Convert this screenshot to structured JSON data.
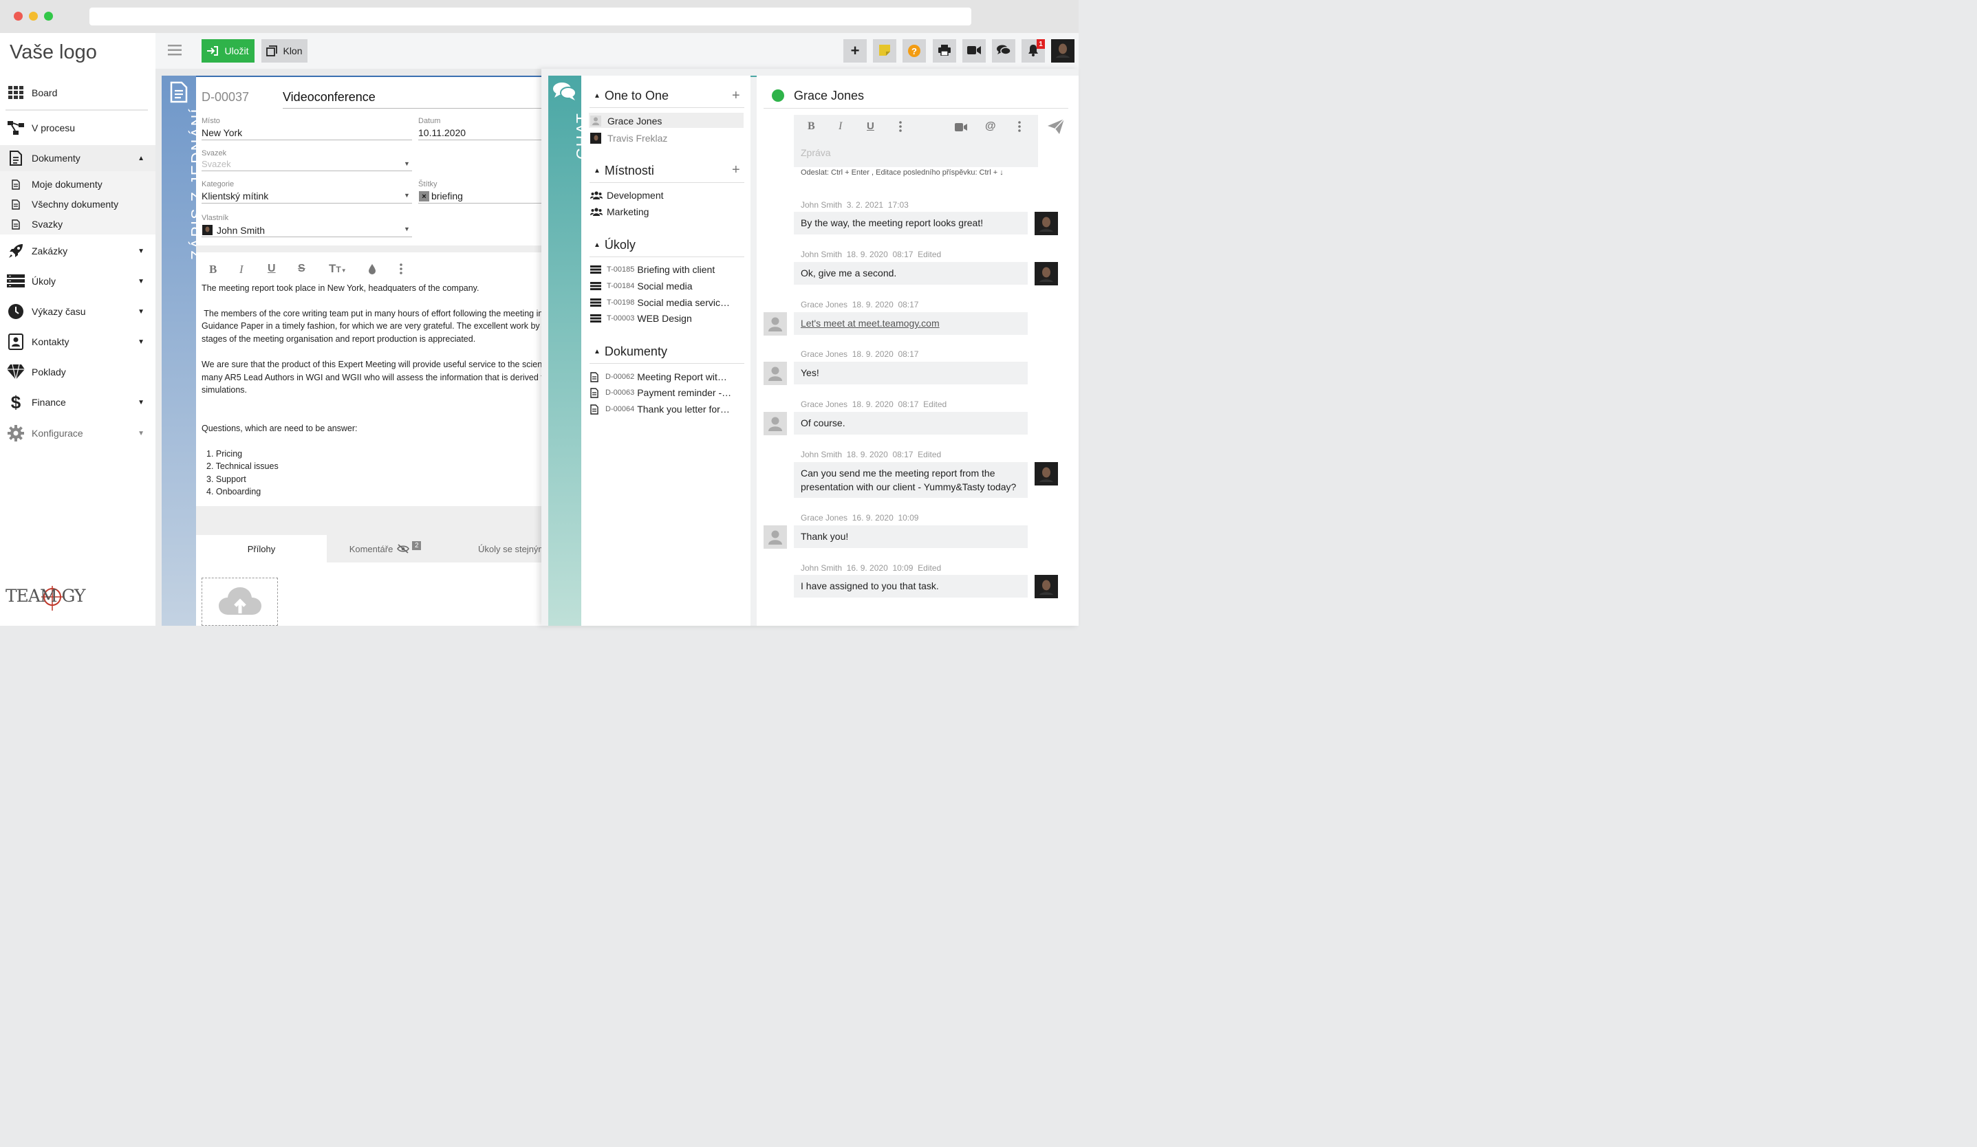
{
  "sidebar": {
    "logo": "Vaše logo",
    "items": [
      {
        "label": "Board"
      },
      {
        "label": "V procesu"
      },
      {
        "label": "Dokumenty"
      },
      {
        "label": "Zakázky"
      },
      {
        "label": "Úkoly"
      },
      {
        "label": "Výkazy času"
      },
      {
        "label": "Kontakty"
      },
      {
        "label": "Poklady"
      },
      {
        "label": "Finance"
      },
      {
        "label": "Konfigurace"
      }
    ],
    "subitems": [
      {
        "label": "Moje dokumenty"
      },
      {
        "label": "Všechny dokumenty"
      },
      {
        "label": "Svazky"
      }
    ],
    "brand": "TEAM GY"
  },
  "toolbar": {
    "save_label": "Uložit",
    "clone_label": "Klon",
    "notification_count": "1",
    "colors": {
      "save": "#2fb34a",
      "help": "#f39c12",
      "note": "#e6c52a",
      "badge": "#e02020"
    }
  },
  "document": {
    "band_title": "ZÁPIS Z JEDNÁNÍ",
    "id": "D-00037",
    "title": "Videoconference",
    "fields": {
      "misto_label": "Místo",
      "misto_value": "New York",
      "datum_label": "Datum",
      "datum_value": "10.11.2020",
      "svazek_label": "Svazek",
      "svazek_placeholder": "Svazek",
      "kategorie_label": "Kategorie",
      "kategorie_value": "Klientský mítink",
      "stitky_label": "Štítky",
      "stitky_value": "briefing",
      "vlastnik_label": "Vlastník",
      "vlastnik_value": "John Smith"
    },
    "body": [
      "The meeting report took place in New York, headquaters of the company.",
      " The members of the core writing team put in many hours of effort following the meeting in",
      "Guidance Paper in a timely fashion, for which we are very grateful. The excellent work by th",
      "stages of the meeting organisation and report production is appreciated.",
      "We are sure that the product of this Expert Meeting will provide useful service to the scient",
      "many AR5 Lead Authors in WGI and WGII who will assess the information that is derived fr",
      "simulations.",
      "Questions, which are need to be answer:"
    ],
    "list": [
      "1. Pricing",
      "2. Technical issues",
      "3. Support",
      "4. Onboarding"
    ],
    "tabs": [
      {
        "label": "Přílohy"
      },
      {
        "label": "Komentáře",
        "count": "2"
      },
      {
        "label": "Úkoly se stejným"
      }
    ]
  },
  "chat": {
    "band_title": "CHAT",
    "sections": {
      "one_to_one": "One to One",
      "rooms": "Místnosti",
      "tasks": "Úkoly",
      "docs": "Dokumenty"
    },
    "contacts": [
      {
        "name": "Grace Jones"
      },
      {
        "name": "Travis Freklaz"
      }
    ],
    "rooms": [
      {
        "name": "Development"
      },
      {
        "name": "Marketing"
      }
    ],
    "tasks": [
      {
        "code": "T-00185",
        "name": "Briefing with client"
      },
      {
        "code": "T-00184",
        "name": "Social media"
      },
      {
        "code": "T-00198",
        "name": "Social media servic…"
      },
      {
        "code": "T-00003",
        "name": "WEB Design"
      }
    ],
    "docs": [
      {
        "code": "D-00062",
        "name": "Meeting Report wit…"
      },
      {
        "code": "D-00063",
        "name": "Payment reminder -…"
      },
      {
        "code": "D-00064",
        "name": "Thank you letter for…"
      }
    ],
    "active_contact": "Grace Jones",
    "status_color": "#2fb34a",
    "message_placeholder": "Zpráva",
    "hint": "Odeslat: Ctrl + Enter , Editace posledního příspěvku: Ctrl + ↓",
    "messages": [
      {
        "author": "John Smith",
        "date": "3. 2. 2021",
        "time": "17:03",
        "edited": "",
        "text": "By the way, the meeting report looks great!"
      },
      {
        "author": "John Smith",
        "date": "18. 9. 2020",
        "time": "08:17",
        "edited": "Edited",
        "text": "Ok, give me a second."
      },
      {
        "author": "Grace Jones",
        "date": "18. 9. 2020",
        "time": "08:17",
        "edited": "",
        "text": "Let's meet at meet.teamogy.com"
      },
      {
        "author": "Grace Jones",
        "date": "18. 9. 2020",
        "time": "08:17",
        "edited": "",
        "text": "Yes!"
      },
      {
        "author": "Grace Jones",
        "date": "18. 9. 2020",
        "time": "08:17",
        "edited": "Edited",
        "text": "Of course."
      },
      {
        "author": "John Smith",
        "date": "18. 9. 2020",
        "time": "08:17",
        "edited": "Edited",
        "text": "Can you send me the meeting report from the presentation with our client - Yummy&Tasty today?"
      },
      {
        "author": "Grace Jones",
        "date": "16. 9. 2020",
        "time": "10:09",
        "edited": "",
        "text": "Thank you!"
      },
      {
        "author": "John Smith",
        "date": "16. 9. 2020",
        "time": "10:09",
        "edited": "Edited",
        "text": "I have assigned to you that task."
      }
    ]
  }
}
